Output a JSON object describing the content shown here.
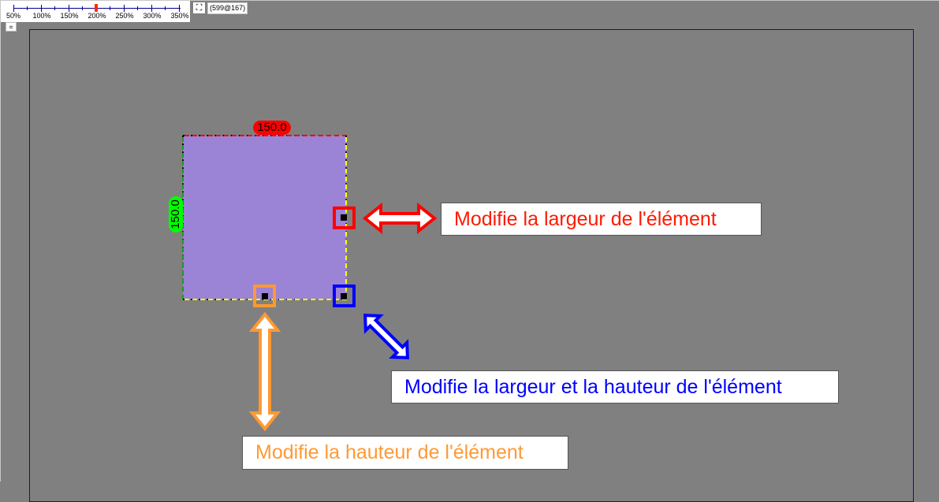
{
  "toolbar": {
    "zoom_levels": [
      "50%",
      "100%",
      "150%",
      "200%",
      "250%",
      "300%",
      "350%"
    ],
    "current_zoom": "200%",
    "fullscreen_icon": "expand-icon",
    "fullscreen_glyph": "⛶",
    "coordinates": "(599@167)",
    "fit_icon": "fit-to-page-icon",
    "fit_glyph": "⌗"
  },
  "element": {
    "width_value": "150.0",
    "height_value": "150.0",
    "fill_color": "#9b83d5"
  },
  "callouts": {
    "width": "Modifie la largeur de l'élément",
    "width_and_height": "Modifie la largeur et la hauteur de l'élément",
    "height": "Modifie la hauteur de l'élément"
  },
  "colors": {
    "canvas_background": "#808080",
    "page_frame": "#0000ff",
    "width_handle": "#ff0000",
    "height_handle": "#ff9933",
    "corner_handle": "#0000ff",
    "width_badge": "#ff0000",
    "height_badge": "#00ff00"
  }
}
